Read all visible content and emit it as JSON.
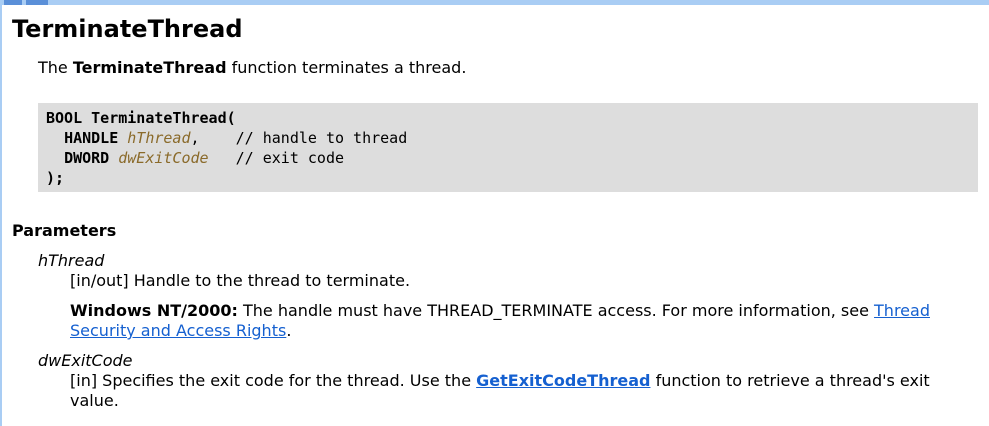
{
  "page": {
    "title": "TerminateThread"
  },
  "intro": {
    "prefix": "The ",
    "function_name": "TerminateThread",
    "suffix": " function terminates a thread."
  },
  "syntax": {
    "line1_type": "BOOL",
    "line1_name": "TerminateThread(",
    "param1_type": "HANDLE",
    "param1_name": "hThread",
    "param1_sep": ",",
    "param1_comment": "// handle to thread",
    "param2_type": "DWORD",
    "param2_name": "dwExitCode",
    "param2_comment": "// exit code",
    "closing": ");"
  },
  "parameters": {
    "heading": "Parameters",
    "hThread": {
      "name": "hThread",
      "desc": "[in/out] Handle to the thread to terminate.",
      "note_label": "Windows NT/2000:",
      "note_text": " The handle must have THREAD_TERMINATE access. For more information, see ",
      "note_link": "Thread Security and Access Rights",
      "note_end": "."
    },
    "dwExitCode": {
      "name": "dwExitCode",
      "desc_prefix": "[in] Specifies the exit code for the thread. Use the ",
      "desc_link": "GetExitCodeThread",
      "desc_suffix": " function to retrieve a thread's exit value."
    }
  },
  "colors": {
    "top_bar": "#a9cdf4",
    "top_bar_accent": "#5a8fd8",
    "code_background": "#dddddd",
    "param_variable": "#8a6a2a",
    "link": "#1560d0"
  }
}
